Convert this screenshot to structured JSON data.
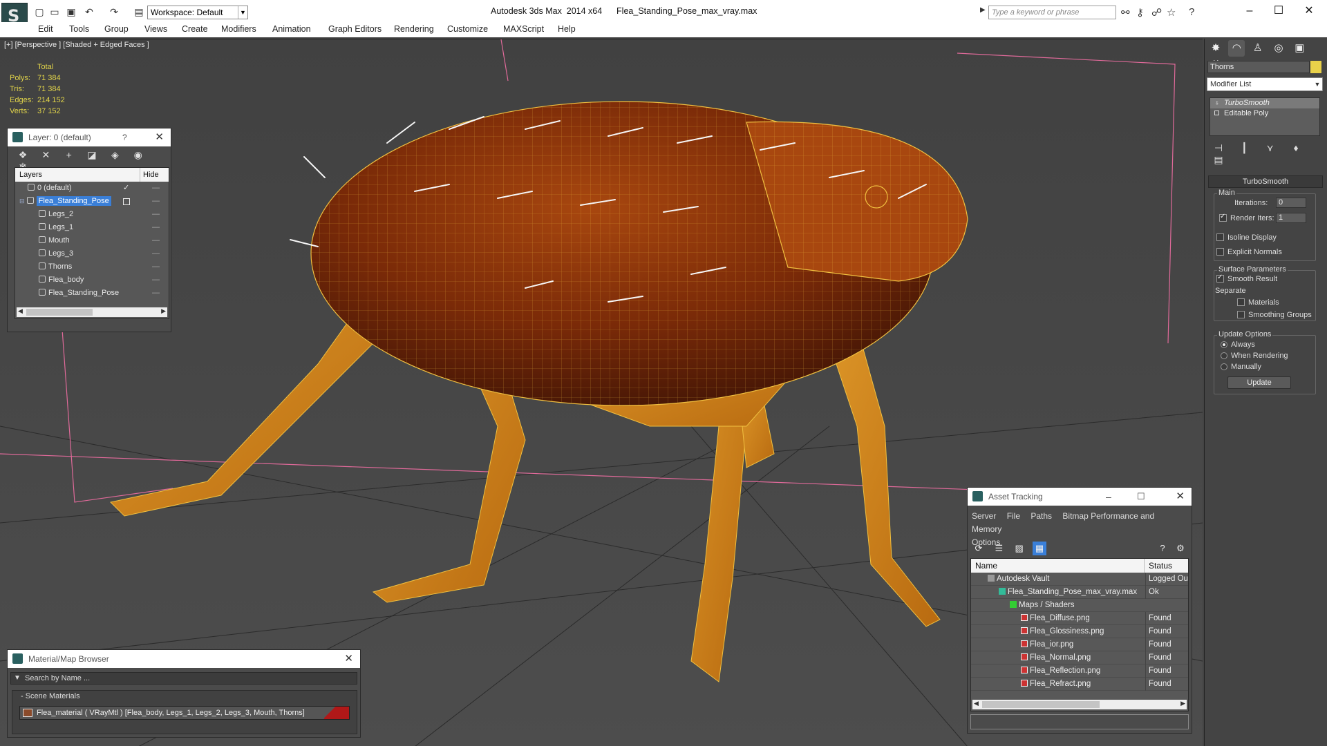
{
  "app": {
    "title": "Autodesk 3ds Max  2014 x64      Flea_Standing_Pose_max_vray.max",
    "workspace": "Workspace: Default",
    "search_placeholder": "Type a keyword or phrase"
  },
  "menu": [
    "Edit",
    "Tools",
    "Group",
    "Views",
    "Create",
    "Modifiers",
    "Animation",
    "Graph Editors",
    "Rendering",
    "Customize",
    "MAXScript",
    "Help"
  ],
  "viewport": {
    "label": "[+] [Perspective ] [Shaded + Edged Faces ]",
    "stats": {
      "header": "Total",
      "rows": [
        {
          "label": "Polys:",
          "value": "71 384"
        },
        {
          "label": "Tris:",
          "value": "71 384"
        },
        {
          "label": "Edges:",
          "value": "214 152"
        },
        {
          "label": "Verts:",
          "value": "37 152"
        }
      ]
    }
  },
  "layers": {
    "title": "Layer: 0 (default)",
    "help": "?",
    "col_layers": "Layers",
    "col_hide": "Hide",
    "rows": [
      "0 (default)",
      "Flea_Standing_Pose",
      "Legs_2",
      "Legs_1",
      "Mouth",
      "Legs_3",
      "Thorns",
      "Flea_body",
      "Flea_Standing_Pose"
    ]
  },
  "command_panel": {
    "object_name": "Thorns",
    "modifier_list": "Modifier List",
    "stack": [
      "TurboSmooth",
      "Editable Poly"
    ],
    "rollout_title": "TurboSmooth",
    "main_label": "Main",
    "iterations_label": "Iterations:",
    "iterations_value": "0",
    "render_iters_label": "Render Iters:",
    "render_iters_value": "1",
    "isoline": "Isoline Display",
    "explicit_normals": "Explicit Normals",
    "surface_params": "Surface Parameters",
    "smooth_result": "Smooth Result",
    "separate": "Separate",
    "materials": "Materials",
    "smoothing_groups": "Smoothing Groups",
    "update_options": "Update Options",
    "always": "Always",
    "when_rendering": "When Rendering",
    "manually": "Manually",
    "update_btn": "Update",
    "accent_color": "#e9d14a"
  },
  "asset_tracking": {
    "title": "Asset Tracking",
    "menu": [
      "Server",
      "File",
      "Paths",
      "Bitmap Performance and Memory",
      "Options"
    ],
    "col_name": "Name",
    "col_status": "Status",
    "rows": [
      {
        "name": "Autodesk Vault",
        "status": "Logged Ou",
        "indent": 1,
        "icon": "vault"
      },
      {
        "name": "Flea_Standing_Pose_max_vray.max",
        "status": "Ok",
        "indent": 2,
        "icon": "max"
      },
      {
        "name": "Maps / Shaders",
        "status": "",
        "indent": 3,
        "icon": "maps"
      },
      {
        "name": "Flea_Diffuse.png",
        "status": "Found",
        "indent": 4,
        "icon": "png"
      },
      {
        "name": "Flea_Glossiness.png",
        "status": "Found",
        "indent": 4,
        "icon": "png"
      },
      {
        "name": "Flea_ior.png",
        "status": "Found",
        "indent": 4,
        "icon": "png"
      },
      {
        "name": "Flea_Normal.png",
        "status": "Found",
        "indent": 4,
        "icon": "png"
      },
      {
        "name": "Flea_Reflection.png",
        "status": "Found",
        "indent": 4,
        "icon": "png"
      },
      {
        "name": "Flea_Refract.png",
        "status": "Found",
        "indent": 4,
        "icon": "png"
      }
    ]
  },
  "material_browser": {
    "title": "Material/Map Browser",
    "search_placeholder": "Search by Name ...",
    "section": "- Scene Materials",
    "material": "Flea_material  ( VRayMtl )  [Flea_body, Legs_1, Legs_2, Legs_3, Mouth, Thorns]"
  }
}
